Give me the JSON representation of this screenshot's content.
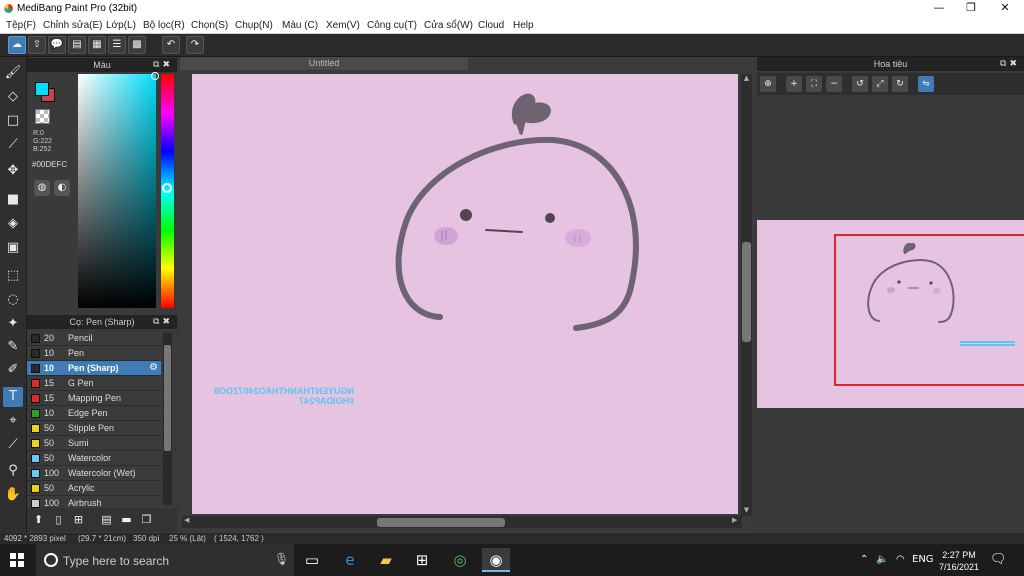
{
  "window": {
    "title": "MediBang Paint Pro (32bit)",
    "minimize": "—",
    "maximize": "❐",
    "close": "✕"
  },
  "menu": [
    "Tệp(F)",
    "Chỉnh sửa(E)",
    "Lớp(L)",
    "Bộ lọc(R)",
    "Chọn(S)",
    "Chụp(N)",
    "Màu (C)",
    "Xem(V)",
    "Công cụ(T)",
    "Cửa sổ(W)",
    "Cloud",
    "Help"
  ],
  "color_panel": {
    "title": "Màu",
    "foreground": "#00DEFC",
    "background": "#C9414A",
    "r": "R:0",
    "g": "G:222",
    "b": "B:252",
    "hex": "#00DEFC"
  },
  "brush_panel": {
    "title": "Cọ: Pen (Sharp)",
    "brushes": [
      {
        "size": "20",
        "name": "Pencil",
        "color": "#2a2a2a"
      },
      {
        "size": "10",
        "name": "Pen",
        "color": "#2a2a2a"
      },
      {
        "size": "10",
        "name": "Pen (Sharp)",
        "color": "#2a2a2a",
        "selected": true
      },
      {
        "size": "15",
        "name": "G Pen",
        "color": "#e02a2a"
      },
      {
        "size": "15",
        "name": "Mapping Pen",
        "color": "#e02a2a"
      },
      {
        "size": "10",
        "name": "Edge Pen",
        "color": "#29a329"
      },
      {
        "size": "50",
        "name": "Stipple Pen",
        "color": "#e8d21c"
      },
      {
        "size": "50",
        "name": "Sumi",
        "color": "#e8d21c"
      },
      {
        "size": "50",
        "name": "Watercolor",
        "color": "#6cc8f0"
      },
      {
        "size": "100",
        "name": "Watercolor (Wet)",
        "color": "#6cc8f0"
      },
      {
        "size": "50",
        "name": "Acrylic",
        "color": "#e8d21c"
      },
      {
        "size": "100",
        "name": "Airbrush",
        "color": "#cccccc"
      }
    ]
  },
  "canvas": {
    "tab_title": "Untitled",
    "background": "#E7C3E2",
    "watermark_line1": "NGUYENTHANHTHAO2407ZOO9",
    "watermark_line2": "#HOIDAP247"
  },
  "navigator": {
    "title": "Hoa tiêu"
  },
  "status": {
    "size": "4092 * 2893 pixel",
    "cm": "(29.7 * 21cm)",
    "dpi": "350 dpi",
    "zoom": "25 % (Lật)",
    "coords": "( 1524, 1762 )"
  },
  "taskbar": {
    "search_placeholder": "Type here to search",
    "language": "ENG",
    "time": "2:27 PM",
    "date": "7/16/2021"
  }
}
